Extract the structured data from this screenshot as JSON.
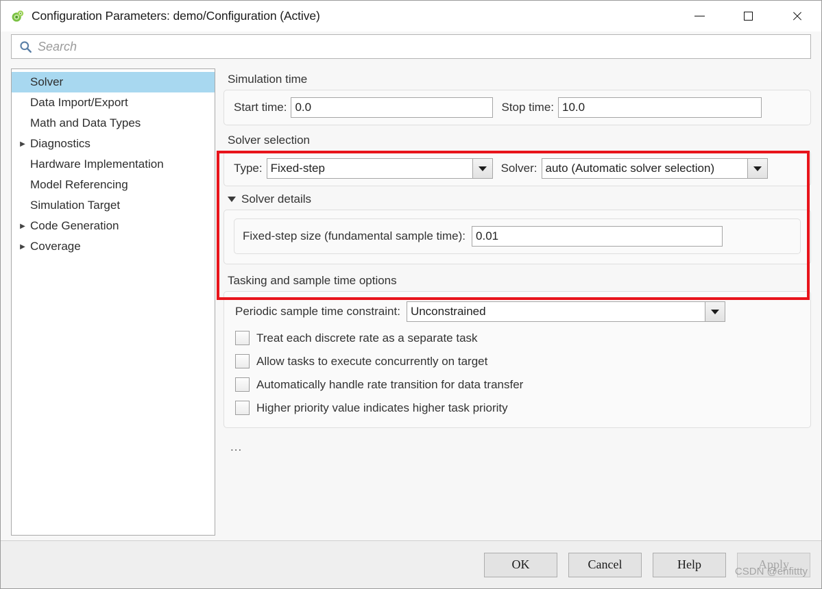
{
  "window": {
    "title": "Configuration Parameters: demo/Configuration (Active)",
    "app_icon": "simulink-gear-icon",
    "minimize_label": "—",
    "maximize_label": "□",
    "close_label": "✕"
  },
  "search": {
    "placeholder": "Search",
    "value": "",
    "icon": "search-icon"
  },
  "sidebar": {
    "items": [
      {
        "label": "Solver",
        "expandable": false,
        "selected": true
      },
      {
        "label": "Data Import/Export",
        "expandable": false,
        "selected": false
      },
      {
        "label": "Math and Data Types",
        "expandable": false,
        "selected": false
      },
      {
        "label": "Diagnostics",
        "expandable": true,
        "selected": false
      },
      {
        "label": "Hardware Implementation",
        "expandable": false,
        "selected": false
      },
      {
        "label": "Model Referencing",
        "expandable": false,
        "selected": false
      },
      {
        "label": "Simulation Target",
        "expandable": false,
        "selected": false
      },
      {
        "label": "Code Generation",
        "expandable": true,
        "selected": false
      },
      {
        "label": "Coverage",
        "expandable": true,
        "selected": false
      }
    ],
    "arrow_glyph": "▶"
  },
  "simulation_time": {
    "group_title": "Simulation time",
    "start_label": "Start time:",
    "start_value": "0.0",
    "stop_label": "Stop time:",
    "stop_value": "10.0"
  },
  "solver_selection": {
    "group_title": "Solver selection",
    "type_label": "Type:",
    "type_value": "Fixed-step",
    "solver_label": "Solver:",
    "solver_value": "auto (Automatic solver selection)"
  },
  "solver_details": {
    "disclosure_label": "Solver details",
    "expanded": true,
    "fixed_step_label": "Fixed-step size (fundamental sample time):",
    "fixed_step_value": "0.01"
  },
  "tasking": {
    "group_title": "Tasking and sample time options",
    "constraint_label": "Periodic sample time constraint:",
    "constraint_value": "Unconstrained",
    "checkboxes": [
      {
        "label": "Treat each discrete rate as a separate task",
        "checked": false
      },
      {
        "label": "Allow tasks to execute concurrently on target",
        "checked": false
      },
      {
        "label": "Automatically handle rate transition for data transfer",
        "checked": false
      },
      {
        "label": "Higher priority value indicates higher task priority",
        "checked": false
      }
    ],
    "overflow_indicator": "..."
  },
  "annotation": {
    "color": "#e8141b",
    "target": "solver-selection-and-details"
  },
  "footer": {
    "ok_label": "OK",
    "cancel_label": "Cancel",
    "help_label": "Help",
    "apply_label": "Apply",
    "apply_disabled": true
  },
  "watermark": {
    "text": "CSDN @ehfittty"
  }
}
